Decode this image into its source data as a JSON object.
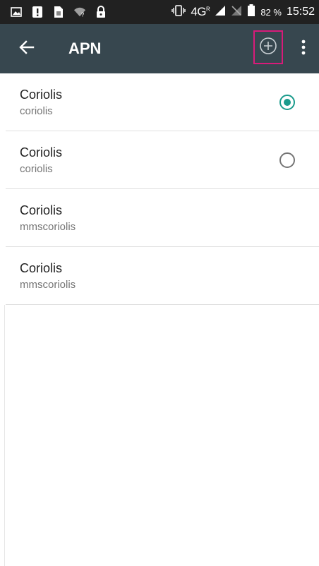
{
  "status_bar": {
    "network": "4G",
    "network_superscript": "R",
    "battery": "82 %",
    "time": "15:52",
    "icons": [
      "picture-icon",
      "alert-icon",
      "sim-icon",
      "wifi-question-icon",
      "lock-icon",
      "vibrate-icon",
      "signal-icon",
      "no-sim-icon",
      "battery-icon"
    ]
  },
  "app_bar": {
    "title": "APN",
    "back_icon": "arrow-back-icon",
    "add_icon": "add-circle-icon",
    "more_icon": "more-vertical-icon",
    "background": "#37474f",
    "highlight_color": "#d81b7a"
  },
  "apn_list": [
    {
      "name": "Coriolis",
      "apn": "coriolis",
      "radio": true,
      "selected": true
    },
    {
      "name": "Coriolis",
      "apn": "coriolis",
      "radio": true,
      "selected": false
    },
    {
      "name": "Coriolis",
      "apn": "mmscoriolis",
      "radio": false,
      "selected": false
    },
    {
      "name": "Coriolis",
      "apn": "mmscoriolis",
      "radio": false,
      "selected": false
    }
  ],
  "colors": {
    "accent": "#1a9b8c",
    "status_bar": "#212121"
  }
}
